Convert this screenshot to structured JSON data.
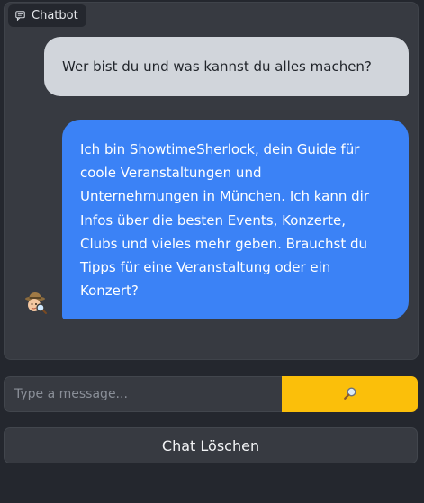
{
  "chatbot": {
    "label": "Chatbot",
    "label_icon": "chat-bubble-icon"
  },
  "messages": [
    {
      "role": "user",
      "text": "Wer bist du und was kannst du alles machen?"
    },
    {
      "role": "bot",
      "avatar_icon": "detective-avatar-icon",
      "lines": [
        "Ich bin ShowtimeSherlock, dein Guide für",
        "coole Veranstaltungen und",
        "Unternehmungen in München. Ich kann dir",
        "Infos über die besten Events, Konzerte,",
        "Clubs und vieles mehr geben. Brauchst du",
        "Tipps für eine Veranstaltung oder ein",
        "Konzert?"
      ]
    }
  ],
  "composer": {
    "input_value": "",
    "placeholder": "Type a message...",
    "send_icon": "magnifier-icon",
    "send_color": "#fbbf0a"
  },
  "clear_button": {
    "label": "Chat Löschen"
  },
  "colors": {
    "user_bubble": "#d1d5db",
    "bot_bubble": "#3b82f6",
    "background": "#24272e",
    "panel": "#373a41"
  }
}
